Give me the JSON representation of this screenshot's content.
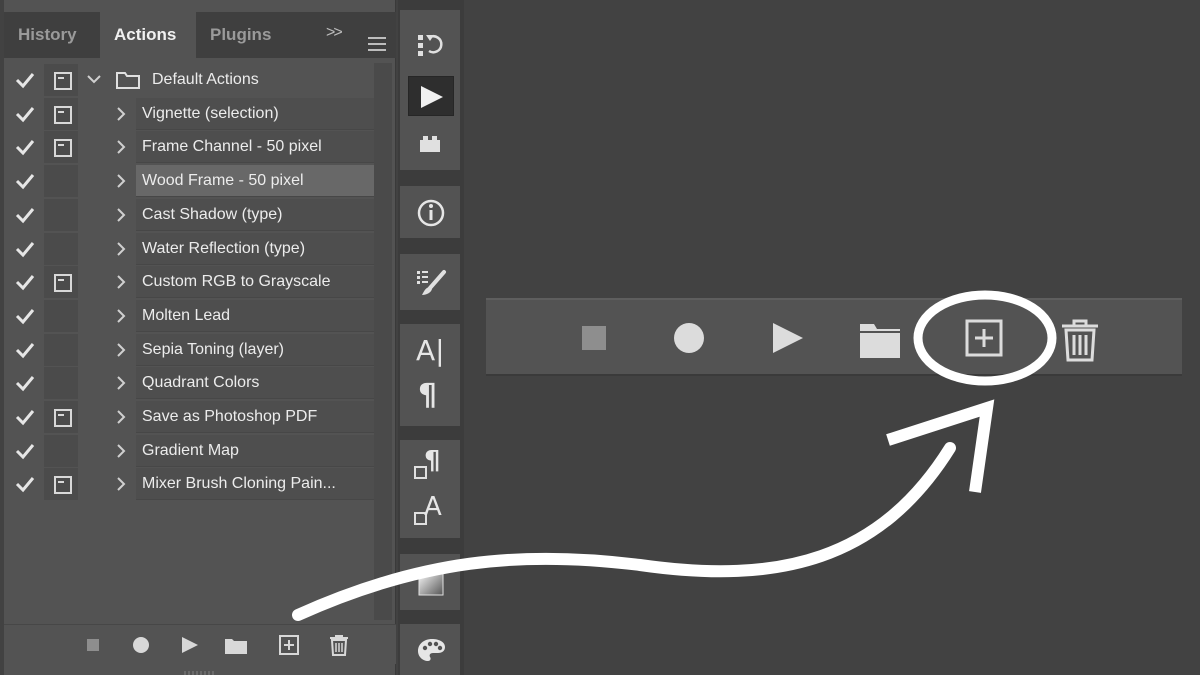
{
  "tabs": [
    {
      "label": "History",
      "active": false
    },
    {
      "label": "Actions",
      "active": true
    },
    {
      "label": "Plugins",
      "active": false
    }
  ],
  "tab_controls": {
    "expand": ">>",
    "menu_icon": "hamburger-menu-icon"
  },
  "actions": {
    "folder": {
      "label": "Default Actions",
      "checked": true,
      "dialog": true,
      "expanded": true
    },
    "items": [
      {
        "label": "Vignette (selection)",
        "checked": true,
        "dialog": true,
        "selected": false
      },
      {
        "label": "Frame Channel - 50 pixel",
        "checked": true,
        "dialog": true,
        "selected": false
      },
      {
        "label": "Wood Frame - 50 pixel",
        "checked": true,
        "dialog": false,
        "selected": true
      },
      {
        "label": "Cast Shadow (type)",
        "checked": true,
        "dialog": false,
        "selected": false
      },
      {
        "label": "Water Reflection (type)",
        "checked": true,
        "dialog": false,
        "selected": false
      },
      {
        "label": "Custom RGB to Grayscale",
        "checked": true,
        "dialog": true,
        "selected": false
      },
      {
        "label": "Molten Lead",
        "checked": true,
        "dialog": false,
        "selected": false
      },
      {
        "label": "Sepia Toning (layer)",
        "checked": true,
        "dialog": false,
        "selected": false
      },
      {
        "label": "Quadrant Colors",
        "checked": true,
        "dialog": false,
        "selected": false
      },
      {
        "label": "Save as Photoshop PDF",
        "checked": true,
        "dialog": true,
        "selected": false
      },
      {
        "label": "Gradient Map",
        "checked": true,
        "dialog": false,
        "selected": false
      },
      {
        "label": "Mixer Brush Cloning Pain...",
        "checked": true,
        "dialog": true,
        "selected": false
      }
    ]
  },
  "toolbar_buttons": [
    {
      "name": "stop-recording",
      "icon": "stop-square-icon"
    },
    {
      "name": "begin-recording",
      "icon": "record-circle-icon"
    },
    {
      "name": "play-selection",
      "icon": "play-triangle-icon"
    },
    {
      "name": "create-new-set",
      "icon": "folder-icon"
    },
    {
      "name": "create-new-action",
      "icon": "new-action-plus-icon"
    },
    {
      "name": "delete",
      "icon": "trash-icon"
    }
  ],
  "dock": {
    "history_icon": "history-brush-icon",
    "actions_icon": "play-icon",
    "plugins_icon": "plugin-brick-icon",
    "info_icon": "info-icon",
    "brush_settings_icon": "brush-settings-icon",
    "character_glyph": "A|",
    "paragraph_glyph": "¶",
    "paragraph_styles_glyph": "¶",
    "character_styles_glyph": "A",
    "gradients_icon": "gradient-icon",
    "color_icon": "palette-icon"
  },
  "colors": {
    "panel_bg": "#535353",
    "app_bg": "#424242",
    "text": "#ececec",
    "annotation": "#ffffff",
    "selected_row": "#686868"
  }
}
